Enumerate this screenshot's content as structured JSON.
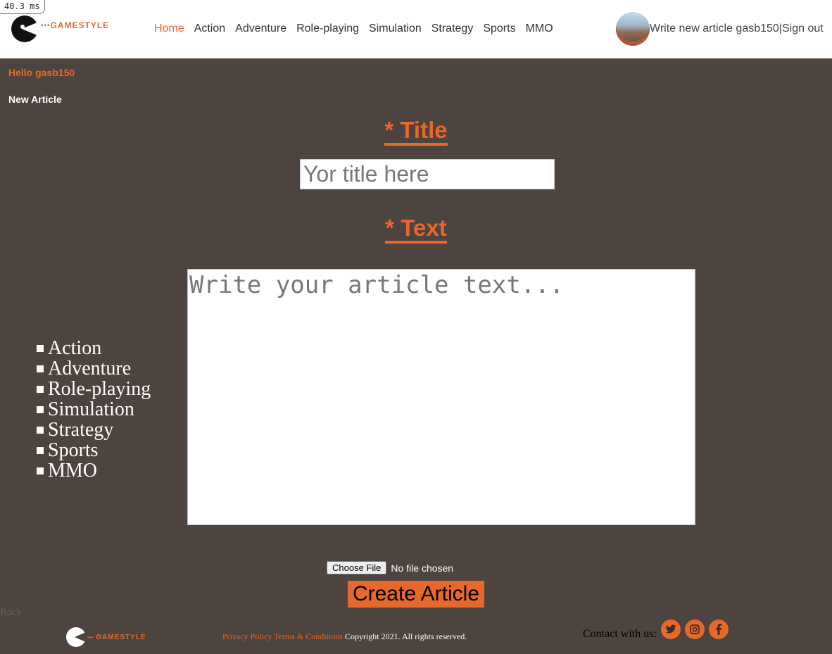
{
  "timing": "40.3 ms",
  "header": {
    "brand": "GAMESTYLE",
    "brand_dots": "•••",
    "nav": [
      "Home",
      "Action",
      "Adventure",
      "Role-playing",
      "Simulation",
      "Strategy",
      "Sports",
      "MMO"
    ],
    "write_link": "Write new article",
    "username": "gasb150",
    "separator": "|",
    "signout": "Sign out"
  },
  "greeting": "Hello gasb150",
  "page_heading": "New Article",
  "form": {
    "title_label": "* Title",
    "title_placeholder": "Yor title here",
    "text_label": "* Text",
    "text_placeholder": "Write your article text...",
    "file_button": "Choose File",
    "file_status": "No file chosen",
    "submit": "Create Article"
  },
  "categories": [
    "Action",
    "Adventure",
    "Role-playing",
    "Simulation",
    "Strategy",
    "Sports",
    "MMO"
  ],
  "back": "Back",
  "footer": {
    "brand": "GAMESTYLE",
    "privacy": "Privacy Policy",
    "terms": "Terms & Conditions",
    "copyright": "Copyright 2021. All rights reserved.",
    "contact": "Contact with us:",
    "social": [
      "twitter-icon",
      "instagram-icon",
      "facebook-icon"
    ]
  },
  "colors": {
    "accent": "#e8672a",
    "background": "#4d433f"
  }
}
